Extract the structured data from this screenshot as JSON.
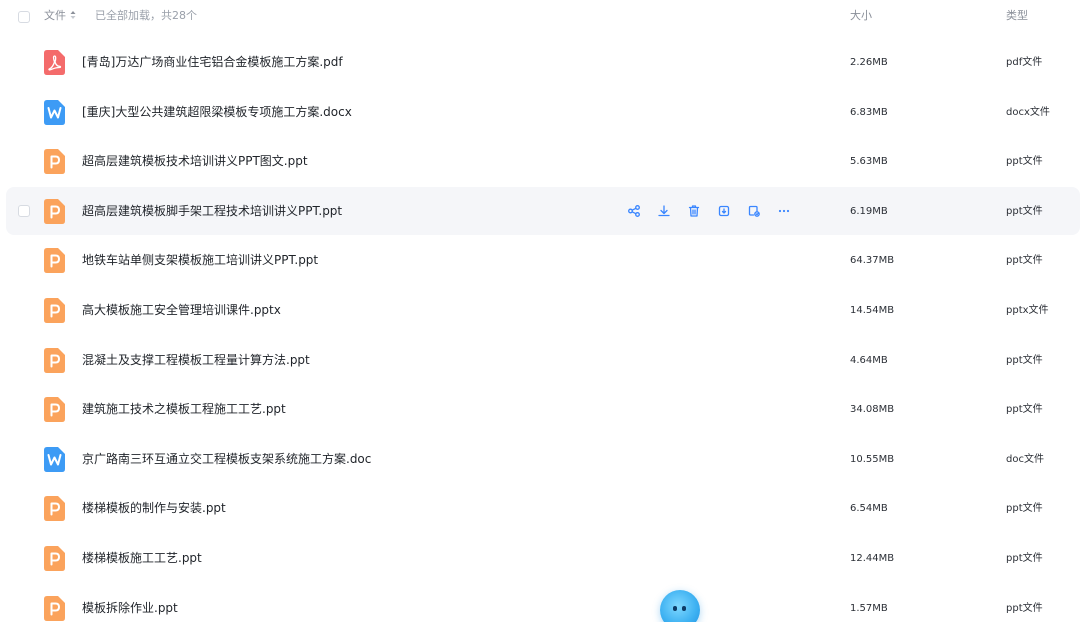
{
  "header": {
    "col_name": "文件",
    "status": "已全部加载，共28个",
    "col_size": "大小",
    "col_type": "类型"
  },
  "colors": {
    "pdf_icon": "#f46b6b",
    "word_icon": "#3d9bf5",
    "ppt_icon": "#fba35c",
    "action_icon": "#3a86ff",
    "hover_row": "#f5f6f9"
  },
  "files": [
    {
      "name": "[青岛]万达广场商业住宅铝合金模板施工方案.pdf",
      "size": "2.26MB",
      "type": "pdf文件",
      "icon": "pdf-icon"
    },
    {
      "name": "[重庆]大型公共建筑超限梁模板专项施工方案.docx",
      "size": "6.83MB",
      "type": "docx文件",
      "icon": "word-icon"
    },
    {
      "name": "超高层建筑模板技术培训讲义PPT图文.ppt",
      "size": "5.63MB",
      "type": "ppt文件",
      "icon": "ppt-icon"
    },
    {
      "name": "超高层建筑模板脚手架工程技术培训讲义PPT.ppt",
      "size": "6.19MB",
      "type": "ppt文件",
      "icon": "ppt-icon"
    },
    {
      "name": "地铁车站单侧支架模板施工培训讲义PPT.ppt",
      "size": "64.37MB",
      "type": "ppt文件",
      "icon": "ppt-icon"
    },
    {
      "name": "高大模板施工安全管理培训课件.pptx",
      "size": "14.54MB",
      "type": "pptx文件",
      "icon": "ppt-icon"
    },
    {
      "name": "混凝土及支撑工程模板工程量计算方法.ppt",
      "size": "4.64MB",
      "type": "ppt文件",
      "icon": "ppt-icon"
    },
    {
      "name": "建筑施工技术之模板工程施工工艺.ppt",
      "size": "34.08MB",
      "type": "ppt文件",
      "icon": "ppt-icon"
    },
    {
      "name": "京广路南三环互通立交工程模板支架系统施工方案.doc",
      "size": "10.55MB",
      "type": "doc文件",
      "icon": "word-icon"
    },
    {
      "name": "楼梯模板的制作与安装.ppt",
      "size": "6.54MB",
      "type": "ppt文件",
      "icon": "ppt-icon"
    },
    {
      "name": "楼梯模板施工工艺.ppt",
      "size": "12.44MB",
      "type": "ppt文件",
      "icon": "ppt-icon"
    },
    {
      "name": "模板拆除作业.ppt",
      "size": "1.57MB",
      "type": "ppt文件",
      "icon": "ppt-icon"
    }
  ],
  "hover_actions": [
    "share-icon",
    "download-icon",
    "delete-icon",
    "copy-icon",
    "move-icon",
    "more-icon"
  ]
}
